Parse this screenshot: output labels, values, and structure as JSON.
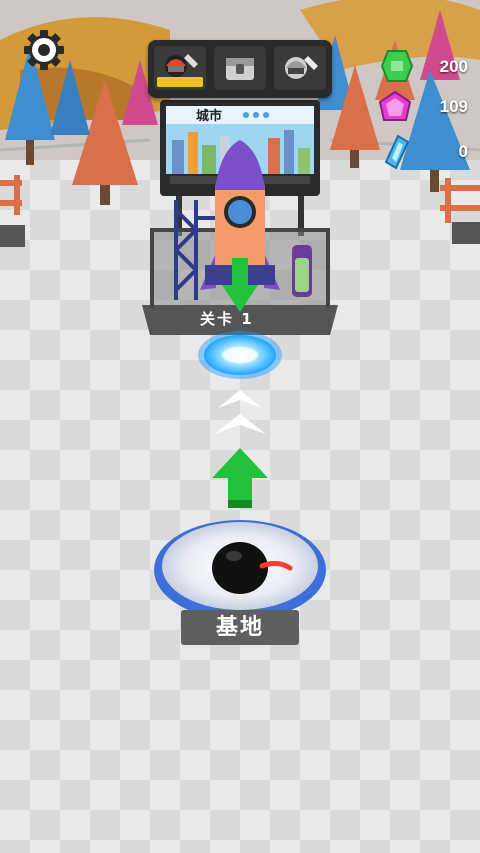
{
  "hud": {
    "settings_icon": "gear-icon",
    "tools": [
      {
        "name": "wrench-helmet-icon",
        "selected": true
      },
      {
        "name": "chest-lock-icon",
        "selected": false
      },
      {
        "name": "wrench-helmet-gray-icon",
        "selected": false
      }
    ],
    "resources": [
      {
        "icon": "green-gem-icon",
        "value": "200",
        "color": "#3ccf4e"
      },
      {
        "icon": "pink-gem-icon",
        "value": "109",
        "color": "#e23ecf"
      },
      {
        "icon": "blue-crystal-icon",
        "value": "0",
        "color": "#4ab8f2"
      }
    ]
  },
  "billboard": {
    "title": "城市"
  },
  "launch_pad": {
    "level_label": "关卡 1"
  },
  "base": {
    "label": "基地"
  },
  "colors": {
    "floor_light": "#e9e9e9",
    "floor_dark": "#d6d6d6",
    "rocket_body": "#f59a6a",
    "rocket_top": "#7a4fc8",
    "arrow_green": "#22c33a",
    "portal": "#5fd2ff",
    "tree_orange": "#d9704a",
    "tree_blue": "#3e8ed0",
    "tree_pink": "#d04a8e"
  }
}
